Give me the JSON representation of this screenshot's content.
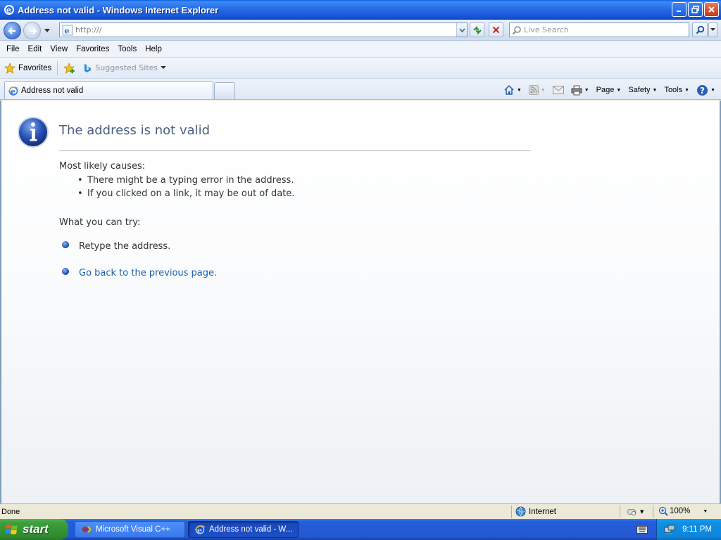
{
  "window": {
    "title": "Address not valid - Windows Internet Explorer"
  },
  "navigation": {
    "address_value": "http:///",
    "search_placeholder": "Live Search"
  },
  "menu": {
    "items": [
      "File",
      "Edit",
      "View",
      "Favorites",
      "Tools",
      "Help"
    ]
  },
  "favorites_bar": {
    "favorites_label": "Favorites",
    "suggested_sites_label": "Suggested Sites"
  },
  "tabs": {
    "active_tab_label": "Address not valid"
  },
  "command_bar": {
    "page_label": "Page",
    "safety_label": "Safety",
    "tools_label": "Tools"
  },
  "error_page": {
    "title": "The address is not valid",
    "causes_heading": "Most likely causes:",
    "causes": [
      "There might be a typing error in the address.",
      "If you clicked on a link, it may be out of date."
    ],
    "try_heading": "What you can try:",
    "retype_text": "Retype the address.",
    "go_back_link": "Go back to the previous page."
  },
  "status_bar": {
    "status_text": "Done",
    "zone_label": "Internet",
    "zoom_level": "100%"
  },
  "taskbar": {
    "start_label": "start",
    "tasks": [
      "Microsoft Visual C++",
      "Address not valid - W..."
    ],
    "clock": "9:11 PM"
  },
  "colors": {
    "title_blue": "#245edb",
    "heading_text": "#4a5f7f",
    "link": "#1b5fa8",
    "start_green": "#3c9e3c"
  }
}
